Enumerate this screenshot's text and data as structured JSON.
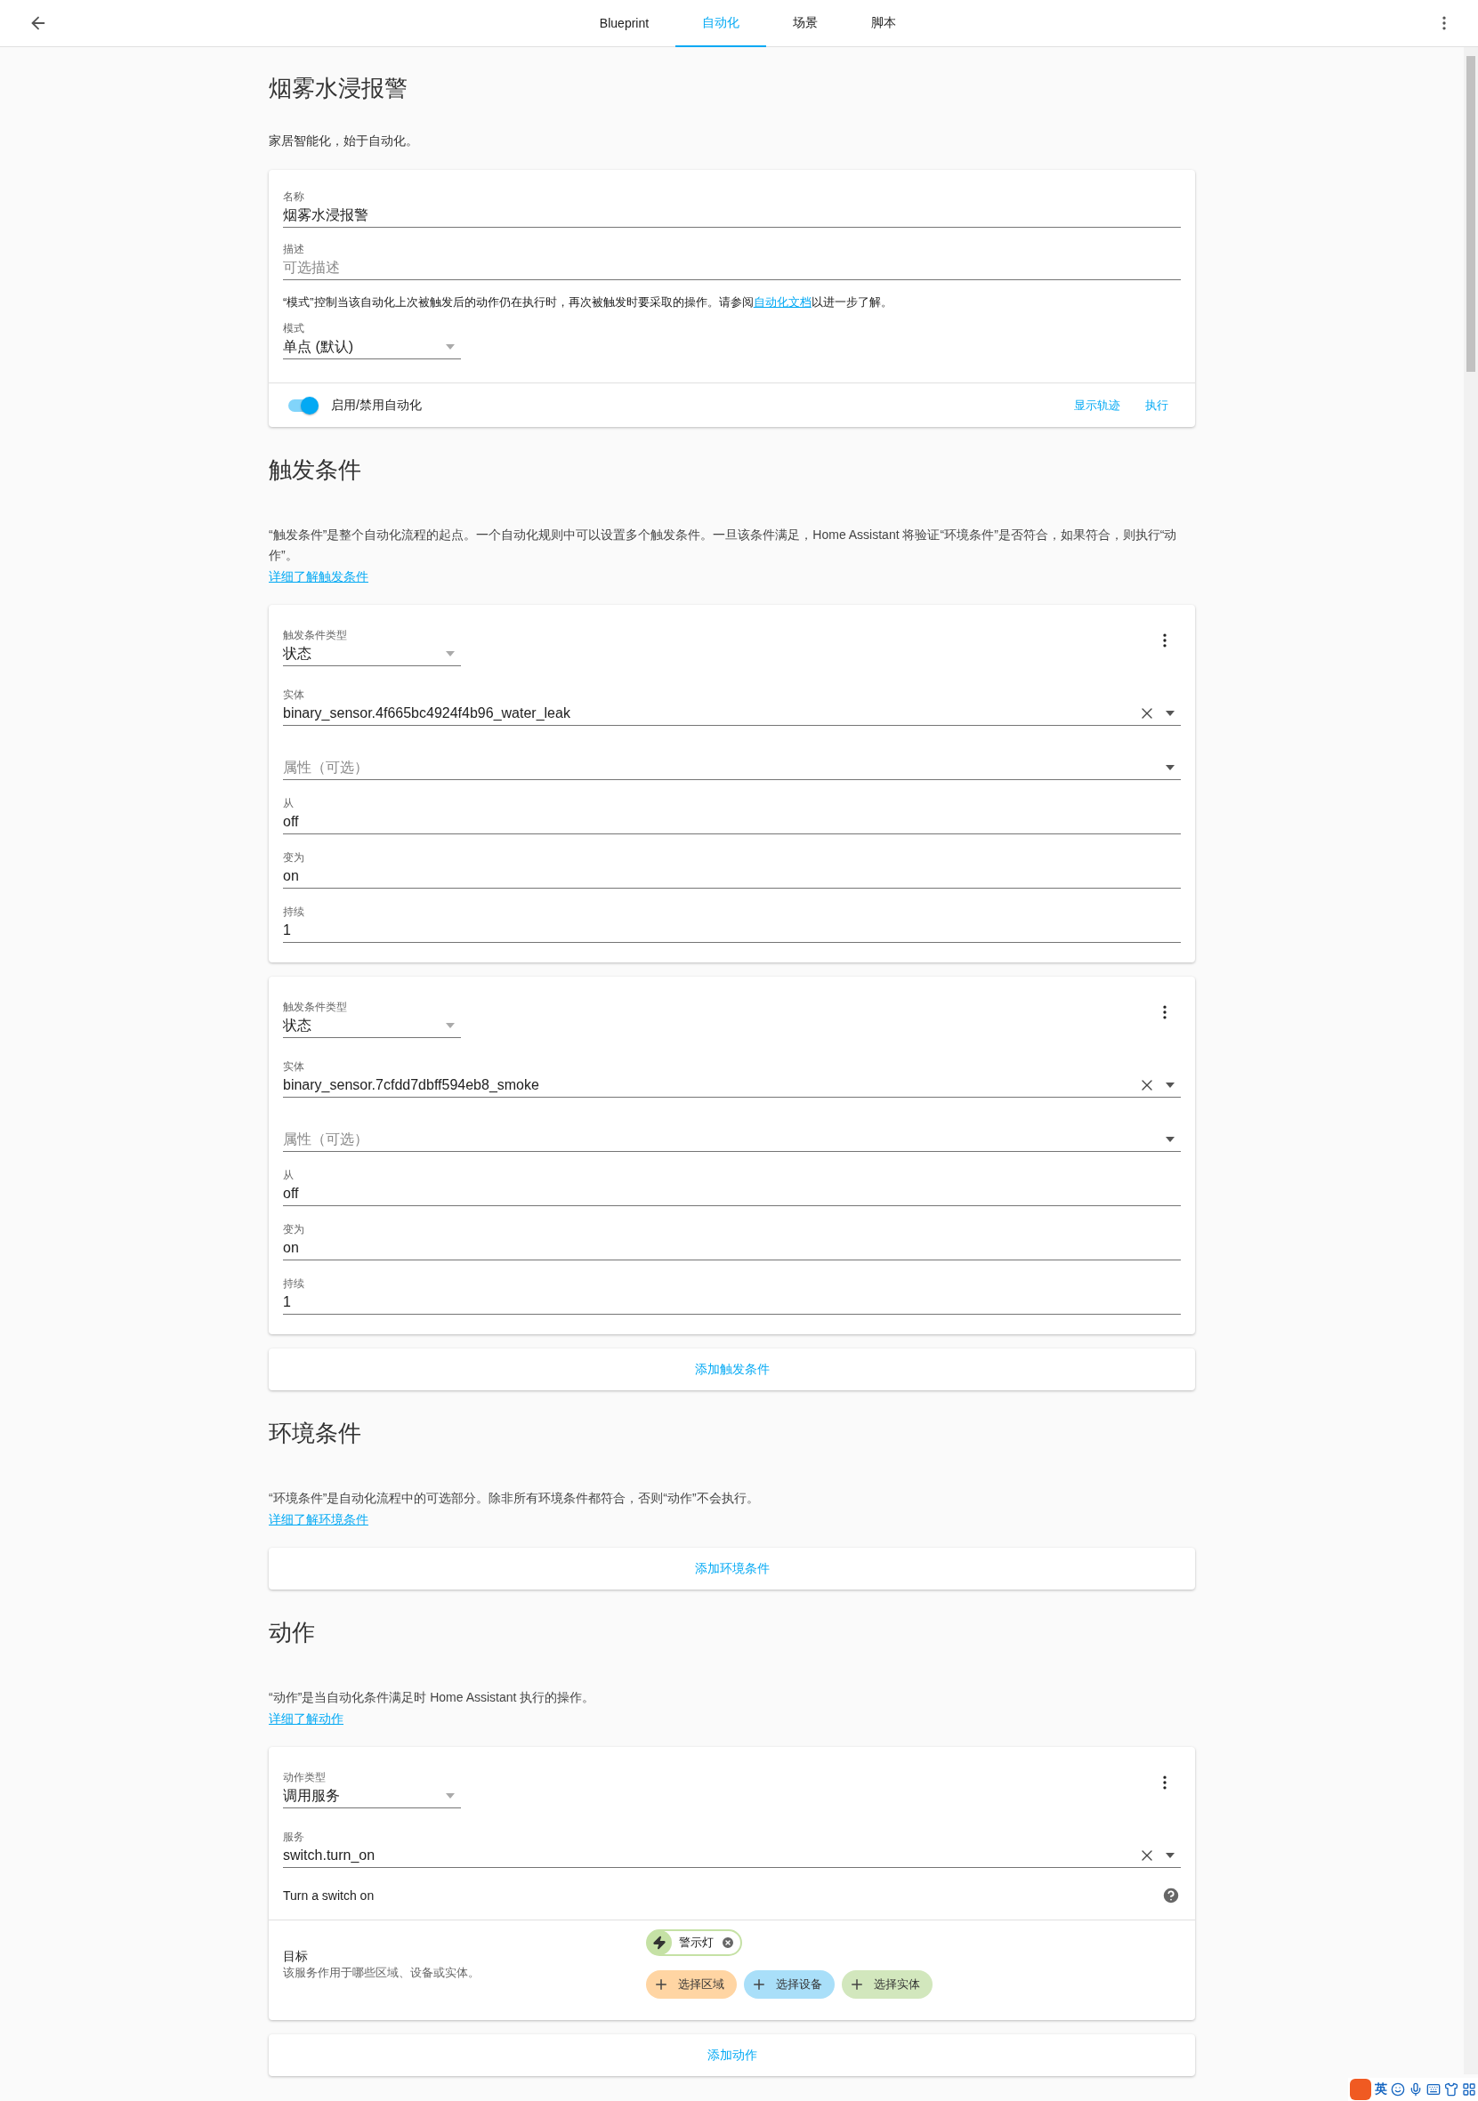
{
  "header": {
    "tabs": [
      {
        "label": "Blueprint",
        "selected": false
      },
      {
        "label": "自动化",
        "selected": true
      },
      {
        "label": "场景",
        "selected": false
      },
      {
        "label": "脚本",
        "selected": false
      }
    ]
  },
  "page": {
    "title": "烟雾水浸报警",
    "subtitle": "家居智能化，始于自动化。"
  },
  "details_card": {
    "fields": [
      {
        "kind": "text",
        "label": "名称",
        "value": "烟雾水浸报警"
      },
      {
        "kind": "text",
        "label": "描述",
        "placeholder": "可选描述"
      }
    ],
    "mode_note": "“模式”控制当该自动化上次被触发后的动作仍在执行时，再次被触发时要采取的操作。请参阅",
    "mode_note_link": "自动化文档",
    "mode_note_end": "以进一步了解。",
    "mode": {
      "label": "模式",
      "value": "单点 (默认)"
    },
    "enabled": true,
    "toggle_label": "启用/禁用自动化",
    "footer_buttons": [
      "显示轨迹",
      "执行"
    ]
  },
  "sections": [
    {
      "heading": "触发条件",
      "description": "“触发条件”是整个自动化流程的起点。一个自动化规则中可以设置多个触发条件。一旦该条件满足，Home Assistant 将验证“环境条件”是否符合，如果符合，则执行“动作”。",
      "link": "详细了解触发条件",
      "cards": [
        {
          "kind": "trigger",
          "type": {
            "label": "触发条件类型",
            "value": "状态"
          },
          "fields": [
            {
              "kind": "entity",
              "label": "实体",
              "value": "binary_sensor.4f665bc4924f4b96_water_leak"
            },
            {
              "kind": "attribute",
              "placeholder": "属性（可选）"
            },
            {
              "kind": "text",
              "label": "从",
              "value": "off"
            },
            {
              "kind": "text",
              "label": "变为",
              "value": "on"
            },
            {
              "kind": "text",
              "label": "持续",
              "value": "1"
            }
          ]
        },
        {
          "kind": "trigger",
          "type": {
            "label": "触发条件类型",
            "value": "状态"
          },
          "fields": [
            {
              "kind": "entity",
              "label": "实体",
              "value": "binary_sensor.7cfdd7dbff594eb8_smoke"
            },
            {
              "kind": "attribute",
              "placeholder": "属性（可选）"
            },
            {
              "kind": "text",
              "label": "从",
              "value": "off"
            },
            {
              "kind": "text",
              "label": "变为",
              "value": "on"
            },
            {
              "kind": "text",
              "label": "持续",
              "value": "1"
            }
          ]
        }
      ],
      "add_button": "添加触发条件"
    },
    {
      "heading": "环境条件",
      "description": "“环境条件”是自动化流程中的可选部分。除非所有环境条件都符合，否则“动作”不会执行。",
      "link": "详细了解环境条件",
      "add_button": "添加环境条件"
    },
    {
      "heading": "动作",
      "description": "“动作”是当自动化条件满足时 Home Assistant 执行的操作。",
      "link": "详细了解动作",
      "cards": [
        {
          "kind": "action",
          "type": {
            "label": "动作类型",
            "value": "调用服务"
          },
          "fields": [
            {
              "kind": "entity",
              "label": "服务",
              "value": "switch.turn_on"
            }
          ],
          "service_description": "Turn a switch on",
          "target": {
            "label": "目标",
            "description": "该服务作用于哪些区域、设备或实体。",
            "chips": [
              {
                "label": "警示灯",
                "color": "#c5e1a5"
              }
            ],
            "pickers": [
              {
                "label": "选择区域",
                "color": "#ffd5a3"
              },
              {
                "label": "选择设备",
                "color": "#a9dff9"
              },
              {
                "label": "选择实体",
                "color": "#d2e7bd"
              }
            ]
          }
        }
      ],
      "add_button": "添加动作"
    }
  ],
  "ime_toolbar": {
    "label": "英"
  }
}
